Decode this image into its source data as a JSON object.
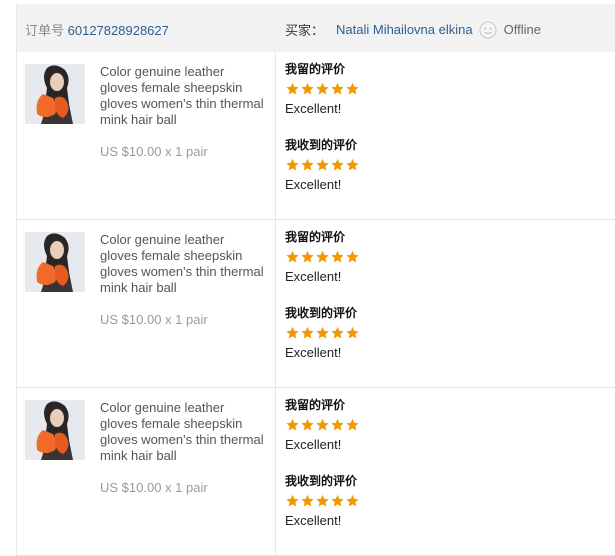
{
  "header": {
    "order_label": "订单号",
    "order_number": "60127828928627",
    "buyer_label": "买家：",
    "buyer_name": "Natali Mihailovna elkina",
    "status": "Offline",
    "status_icon": "smiley-icon"
  },
  "items": [
    {
      "title": "Color genuine leather gloves female sheepskin gloves women's thin thermal mink hair ball",
      "price": "US $10.00 x 1 pair",
      "given": {
        "label": "我留的评价",
        "rating": 5,
        "comment": "Excellent!"
      },
      "received": {
        "label": "我收到的评价",
        "rating": 5,
        "comment": "Excellent!"
      }
    },
    {
      "title": "Color genuine leather gloves female sheepskin gloves women's thin thermal mink hair ball",
      "price": "US $10.00 x 1 pair",
      "given": {
        "label": "我留的评价",
        "rating": 5,
        "comment": "Excellent!"
      },
      "received": {
        "label": "我收到的评价",
        "rating": 5,
        "comment": "Excellent!"
      }
    },
    {
      "title": "Color genuine leather gloves female sheepskin gloves women's thin thermal mink hair ball",
      "price": "US $10.00 x 1 pair",
      "given": {
        "label": "我留的评价",
        "rating": 5,
        "comment": "Excellent!"
      },
      "received": {
        "label": "我收到的评价",
        "rating": 5,
        "comment": "Excellent!"
      }
    }
  ],
  "colors": {
    "link": "#2e5f8e",
    "star": "#f39800",
    "header_bg": "#f2f2f2"
  }
}
